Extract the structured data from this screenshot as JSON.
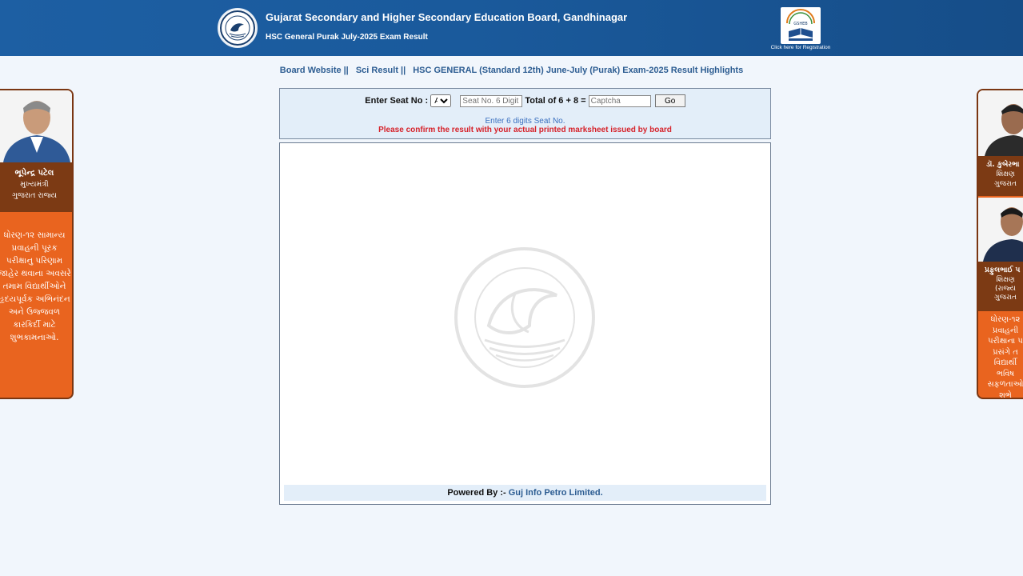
{
  "header": {
    "title": "Gujarat Secondary and Higher Secondary Education Board, Gandhinagar",
    "subtitle": "HSC General Purak July-2025 Exam Result",
    "registration_caption": "Click here for Registration",
    "registration_logo_text": "GSHEB"
  },
  "nav": {
    "items": [
      {
        "label": "Board Website",
        "sep": "||"
      },
      {
        "label": "Sci Result",
        "sep": "||"
      },
      {
        "label": "HSC GENERAL (Standard 12th) June-July (Purak) Exam-2025 Result Highlights",
        "sep": ""
      }
    ]
  },
  "form": {
    "seat_label": "Enter Seat No :",
    "seat_prefix": "A",
    "seat_placeholder": "Seat No. 6 Digit",
    "captcha_question": "Total of 6 + 8 =",
    "captcha_placeholder": "Captcha",
    "go_label": "Go",
    "hint": "Enter 6 digits Seat No.",
    "warning": "Please confirm the result with your actual printed marksheet issued by board"
  },
  "footer": {
    "powered_label": "Powered By :-",
    "powered_link": "Guj Info Petro Limited."
  },
  "left_banner": {
    "name": "ભૂપેન્દ્ર પટેલ",
    "role": "મુખ્યમંત્રી",
    "state": "ગુજરાત રાજ્ય",
    "message": [
      "ધોરણ-૧૨ સામાન્ય",
      "પ્રવાહની પૂરક",
      "પરીક્ષાનુ પરિણામ",
      "જાહેર થવાના અવસરે",
      "તમામ વિદ્યાર્થીઓને",
      "હૃદયપૂર્વક અભિનંદન",
      "અને ઉજ્જવળ",
      "કારકિર્દી માટે",
      "શુભકામનાઓ."
    ]
  },
  "right_banner": {
    "person1": {
      "name": "ડૉ. કુબેરભા",
      "role": "શિક્ષણ",
      "state": "ગુજરાત"
    },
    "person2": {
      "name": "પ્રફુલભાઈ પ",
      "role": "શિક્ષણ",
      "role2": "(રાજ્ય",
      "state": "ગુજરાત"
    },
    "message": [
      "ધોરણ-૧૨",
      "પ્રવાહની",
      "પરીક્ષાના પ",
      "પ્રસંગે ત",
      "વિદ્યાર્થી",
      "ભવિષ",
      "સફળતાઓ",
      "શુભે"
    ]
  },
  "colors": {
    "header_blue": "#1a5a9c",
    "nav_link": "#2d5d92",
    "warning_red": "#d6222a",
    "hint_blue": "#3a6fbf",
    "banner_orange": "#e9641f",
    "banner_brown": "#7c3a14"
  }
}
